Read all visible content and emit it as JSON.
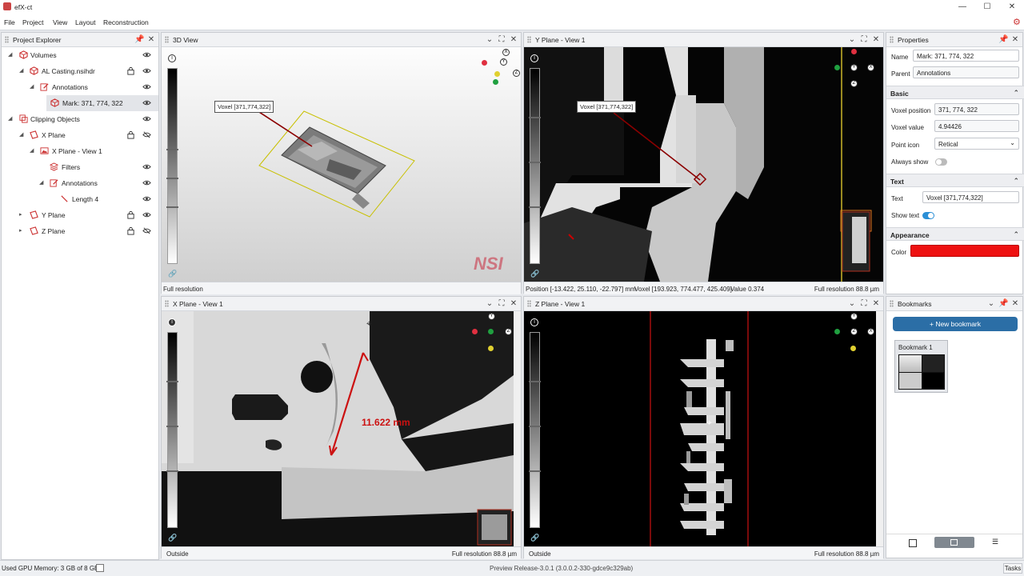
{
  "app": {
    "title": "efX-ct"
  },
  "menu": [
    "File",
    "Project",
    "View",
    "Layout",
    "Reconstruction"
  ],
  "explorer": {
    "title": "Project Explorer",
    "items": [
      {
        "label": "Volumes"
      },
      {
        "label": "AL Casting.nsihdr"
      },
      {
        "label": "Annotations"
      },
      {
        "label": "Mark: 371, 774, 322"
      },
      {
        "label": "Clipping Objects"
      },
      {
        "label": "X Plane"
      },
      {
        "label": "X Plane - View 1"
      },
      {
        "label": "Filters"
      },
      {
        "label": "Annotations"
      },
      {
        "label": "Length 4"
      },
      {
        "label": "Y Plane"
      },
      {
        "label": "Z Plane"
      }
    ]
  },
  "views": {
    "view3d": {
      "title": "3D View",
      "footer_left": "Full resolution",
      "voxel_label": "Voxel [371,774,322]",
      "watermark": "NSI"
    },
    "yplane": {
      "title": "Y Plane - View 1",
      "position": "Position [-13.422, 25.110, -22.797] mm",
      "voxel": "Voxel [193.923, 774.477, 425.409]",
      "value": "Value 0.374",
      "footer_right": "Full resolution 88.8 µm",
      "voxel_label": "Voxel [371,774,322]"
    },
    "xplane": {
      "title": "X Plane - View 1",
      "footer_left": "Outside",
      "footer_right": "Full resolution 88.8 µm",
      "measure": "11.622 mm"
    },
    "zplane": {
      "title": "Z Plane - View 1",
      "footer_left": "Outside",
      "footer_right": "Full resolution 88.8 µm"
    }
  },
  "properties": {
    "title": "Properties",
    "name_label": "Name",
    "name_value": "Mark: 371, 774, 322",
    "parent_label": "Parent",
    "parent_value": "Annotations",
    "basic": "Basic",
    "voxel_position_label": "Voxel position",
    "voxel_position": "371, 774, 322",
    "voxel_value_label": "Voxel value",
    "voxel_value": "4.94426",
    "point_icon_label": "Point icon",
    "point_icon": "Retical",
    "always_show_label": "Always show",
    "text_section": "Text",
    "text_label": "Text",
    "text_value": "Voxel [371,774,322]",
    "show_text_label": "Show text",
    "appearance": "Appearance",
    "color_label": "Color",
    "color_value": "#ee1111"
  },
  "bookmarks": {
    "title": "Bookmarks",
    "new_button": "New bookmark",
    "items": [
      {
        "label": "Bookmark 1"
      }
    ]
  },
  "statusbar": {
    "gpu": "Used GPU Memory: 3 GB of 8 GB",
    "version": "Preview Release-3.0.1 (3.0.0.2-330-gdce9c329ab)",
    "tasks": "Tasks"
  },
  "colors": {
    "accent": "#2b6ea6",
    "marker_red": "#8b0000",
    "mark_color": "#ee1111"
  }
}
